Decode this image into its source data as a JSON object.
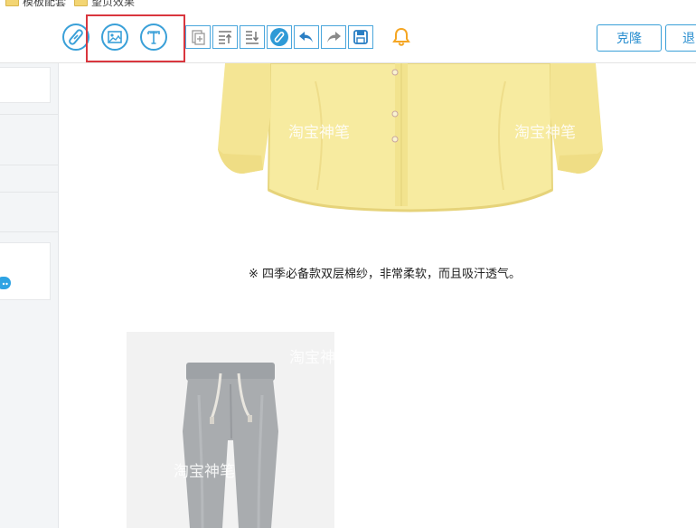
{
  "bookmarks": [
    {
      "label": "模板配套"
    },
    {
      "label": "望页效果"
    }
  ],
  "toolbar": {
    "circle_tools": [
      {
        "icon": "link-edit-icon"
      },
      {
        "icon": "image-icon"
      },
      {
        "icon": "text-icon"
      }
    ],
    "square_tools": [
      {
        "icon": "copy-add-icon"
      },
      {
        "icon": "move-up-icon"
      },
      {
        "icon": "move-down-icon"
      },
      {
        "icon": "link-icon"
      },
      {
        "icon": "undo-icon"
      },
      {
        "icon": "redo-icon"
      },
      {
        "icon": "save-icon"
      }
    ],
    "notification_icon": "bell-icon",
    "clone_label": "克隆",
    "exit_label": "退",
    "accent_color": "#3aa0d8",
    "highlight_color": "#d9363e"
  },
  "canvas": {
    "watermark": "淘宝神笔",
    "caption": "※ 四季必备款双层棉纱，非常柔软，而且吸汗透气。",
    "shirt_color": "#f7eba0",
    "pants_color": "#a9acaf"
  }
}
